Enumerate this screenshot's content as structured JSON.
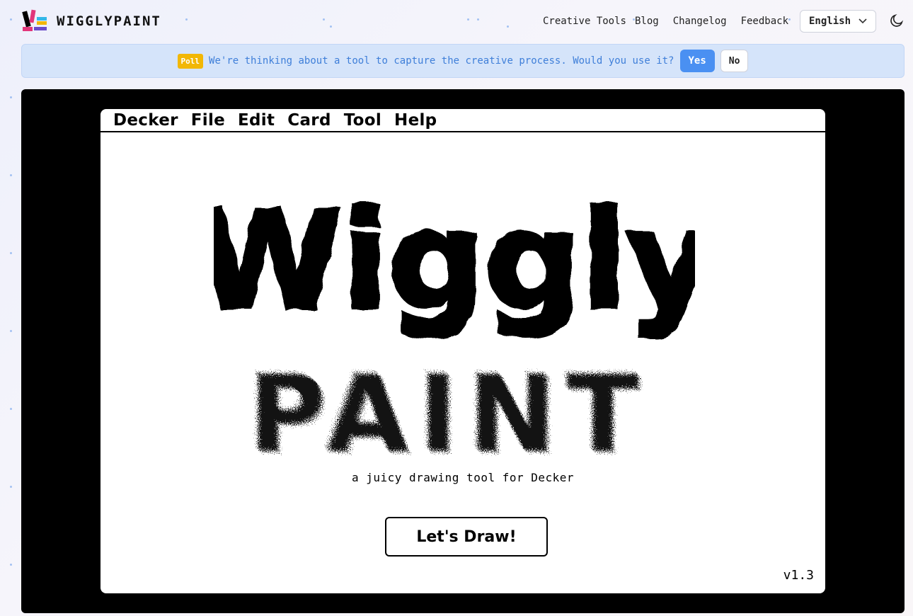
{
  "brand": {
    "name": "WIGGLYPAINT",
    "logo_icon": "pencil-logo-icon"
  },
  "nav": {
    "links": [
      "Creative Tools",
      "Blog",
      "Changelog",
      "Feedback"
    ],
    "language": "English",
    "theme_icon": "moon-icon"
  },
  "poll": {
    "badge": "Poll",
    "question": "We're thinking about a tool to capture the creative process. Would you use it?",
    "yes_label": "Yes",
    "no_label": "No"
  },
  "decker": {
    "menu": [
      "Decker",
      "File",
      "Edit",
      "Card",
      "Tool",
      "Help"
    ],
    "title_line1": "Wiggly",
    "title_line2": "PAINT",
    "tagline": "a juicy drawing tool for Decker",
    "cta_label": "Let's Draw!",
    "version": "v1.3"
  },
  "colors": {
    "accent": "#4a90f2",
    "poll_bg": "#d5e4fa",
    "poll_text": "#3f7fd9",
    "badge": "#f2b705"
  }
}
